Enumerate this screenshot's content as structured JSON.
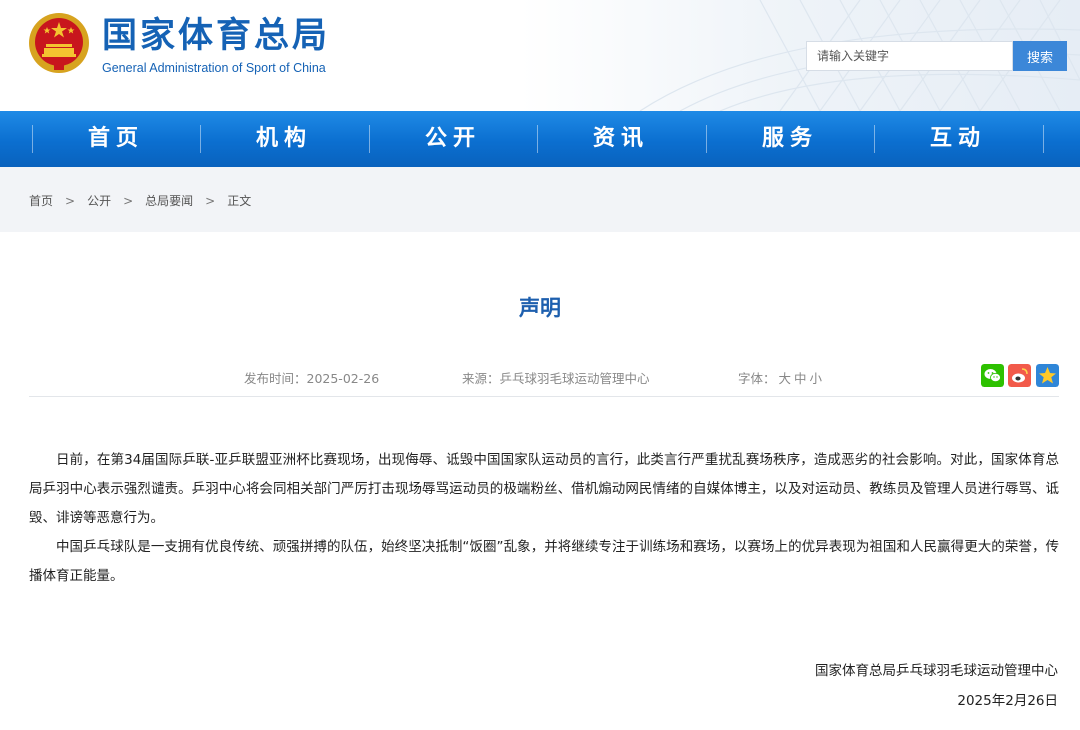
{
  "header": {
    "title": "国家体育总局",
    "subtitle": "General Administration of Sport of China",
    "search_placeholder": "请输入关键字",
    "search_button": "搜索"
  },
  "nav": {
    "items": [
      {
        "label": "首页"
      },
      {
        "label": "机构"
      },
      {
        "label": "公开"
      },
      {
        "label": "资讯"
      },
      {
        "label": "服务"
      },
      {
        "label": "互动"
      }
    ]
  },
  "breadcrumb": {
    "items": [
      "首页",
      "公开",
      "总局要闻",
      "正文"
    ],
    "separator": ">"
  },
  "article": {
    "title": "声明",
    "publish_time": "发布时间：2025-02-26",
    "source": "来源：乒乓球羽毛球运动管理中心",
    "font_label": "字体：",
    "font_options": [
      "大",
      "中",
      "小"
    ],
    "paragraphs": [
      "日前，在第34届国际乒联-亚乒联盟亚洲杯比赛现场，出现侮辱、诋毁中国国家队运动员的言行，此类言行严重扰乱赛场秩序，造成恶劣的社会影响。对此，国家体育总局乒羽中心表示强烈谴责。乒羽中心将会同相关部门严厉打击现场辱骂运动员的极端粉丝、借机煽动网民情绪的自媒体博主，以及对运动员、教练员及管理人员进行辱骂、诋毁、诽谤等恶意行为。",
      "中国乒乓球队是一支拥有优良传统、顽强拼搏的队伍，始终坚决抵制“饭圈”乱象，并将继续专注于训练场和赛场，以赛场上的优异表现为祖国和人民赢得更大的荣誉，传播体育正能量。"
    ],
    "signature": "国家体育总局乒乓球羽毛球运动管理中心",
    "date": "2025年2月26日"
  },
  "share": [
    {
      "icon": "wechat-icon",
      "color": "#2dc100"
    },
    {
      "icon": "weibo-icon",
      "color": "#f25a4a"
    },
    {
      "icon": "qzone-icon",
      "color": "#2f86d8"
    }
  ],
  "colors": {
    "brand": "#1562b5",
    "nav": "#0b6fd0",
    "title": "#1d5fae"
  }
}
